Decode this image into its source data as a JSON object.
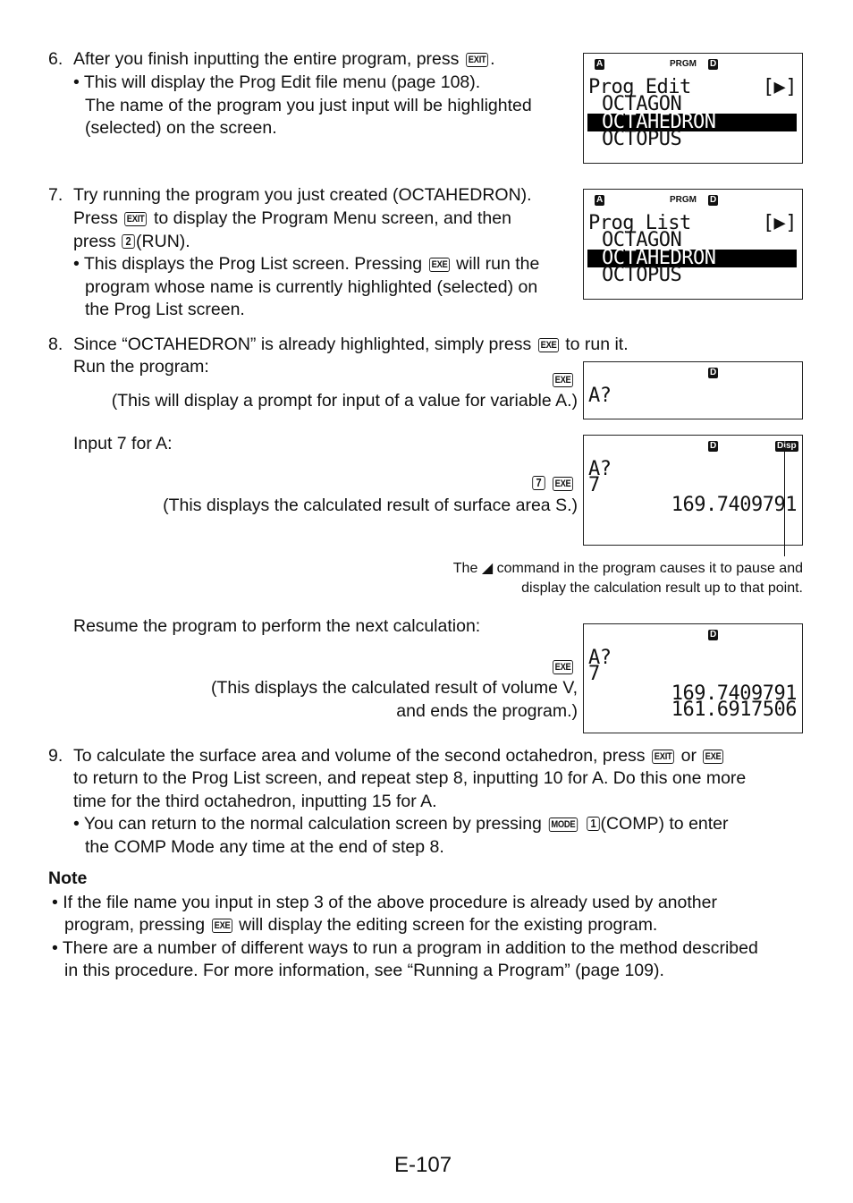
{
  "steps": {
    "s6": {
      "num": "6.",
      "line1": "After you finish inputting the entire program, press",
      "key1": "EXIT",
      "line1_end": ".",
      "bullet_l1": "• This will display the Prog Edit file menu (page 108).",
      "bullet_l2": "The name of the program you just input will be highlighted",
      "bullet_l3": "(selected) on the screen."
    },
    "s7": {
      "num": "7.",
      "line1": "Try running the program you just created (OCTAHEDRON).",
      "line2a": "Press",
      "key_exit": "EXIT",
      "line2b": "to display the Program Menu screen, and then",
      "line3a": "press",
      "key_2": "2",
      "line3b": "(RUN).",
      "bullet_l1a": "• This displays the Prog List screen. Pressing",
      "key_exe": "EXE",
      "bullet_l1b": "will run the",
      "bullet_l2": "program whose name is currently highlighted (selected) on",
      "bullet_l3": "the Prog List screen."
    },
    "s8": {
      "num": "8.",
      "line1a": "Since “OCTAHEDRON” is already highlighted, simply press",
      "key_exe": "EXE",
      "line1b": "to run it.",
      "run_label": "Run the program:",
      "run_key": "EXE",
      "run_desc": "(This will display a prompt for input of a value for variable A.)",
      "input_label": "Input 7 for A:",
      "input_key1": "7",
      "input_key2": "EXE",
      "input_desc": "(This displays the calculated result of surface area S.)",
      "callout_l1a": "The",
      "callout_symbol": "◢",
      "callout_l1b": "command in the program causes it to pause and",
      "callout_l2": "display the calculation result up to that point.",
      "resume_label": "Resume the program to perform the next calculation:",
      "resume_key": "EXE",
      "resume_desc_l1": "(This displays the calculated result of volume V,",
      "resume_desc_l2": "and ends the program.)"
    },
    "s9": {
      "num": "9.",
      "line1a": "To calculate the surface area and volume of the second octahedron, press",
      "key_exit": "EXIT",
      "line1b": "or",
      "key_exe": "EXE",
      "line2": "to return to the Prog List screen, and repeat step 8, inputting 10 for A. Do this one more",
      "line3": "time for the third octahedron, inputting 15 for A.",
      "bullet_l1a": "• You can return to the normal calculation screen by pressing",
      "key_mode": "MODE",
      "key_1": "1",
      "bullet_l1b": "(COMP) to enter",
      "bullet_l2": "the COMP Mode any time at the end of step 8."
    }
  },
  "screens": {
    "prog_edit": {
      "ind_a": "A",
      "ind_prgm": "PRGM",
      "ind_d": "D",
      "title": "Prog Edit",
      "arrow": "[▶]",
      "items": [
        "OCTAGON",
        "OCTAHEDRON",
        "OCTOPUS"
      ],
      "selected": "OCTAHEDRON"
    },
    "prog_list": {
      "ind_a": "A",
      "ind_prgm": "PRGM",
      "ind_d": "D",
      "title": "Prog List",
      "arrow": "[▶]",
      "items": [
        "OCTAGON",
        "OCTAHEDRON",
        "OCTOPUS"
      ],
      "selected": "OCTAHEDRON"
    },
    "prompt": {
      "ind_d": "D",
      "line1": "A?"
    },
    "result_s": {
      "ind_d": "D",
      "ind_disp": "Disp",
      "line1": "A?",
      "line2": "7",
      "result": "169.7409791"
    },
    "result_v": {
      "ind_d": "D",
      "line1": "A?",
      "line2": "7",
      "result1": "169.7409791",
      "result2": "161.6917506"
    }
  },
  "note": {
    "title": "Note",
    "b1_l1": "• If the file name you input in step 3 of the above procedure is already used by another",
    "b1_l2a": "program, pressing",
    "b1_key": "EXE",
    "b1_l2b": "will display the editing screen for the existing program.",
    "b2_l1": "• There are a number of different ways to run a program in addition to the method described",
    "b2_l2": "in this procedure. For more information, see “Running a Program” (page 109)."
  },
  "page_number": "E-107"
}
